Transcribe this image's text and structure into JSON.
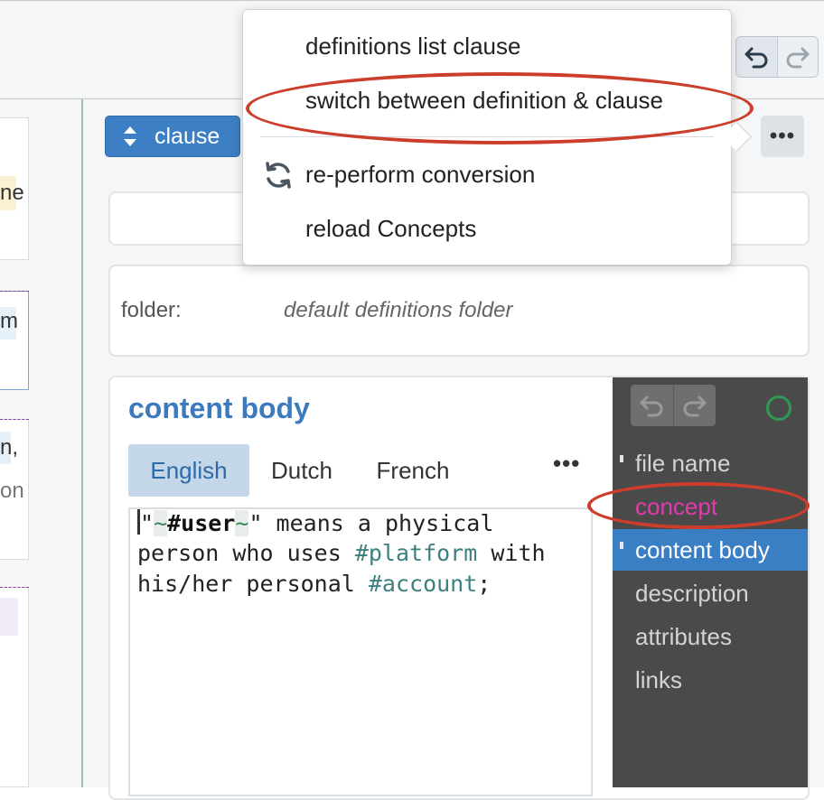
{
  "left_fragments": [
    "ne",
    "m",
    "n,",
    "on"
  ],
  "clause_button": {
    "label": "clause"
  },
  "more_button": {
    "label": "•••"
  },
  "folder": {
    "label": "folder:",
    "value": "default definitions folder"
  },
  "content": {
    "title": "content body",
    "languages": [
      "English",
      "Dutch",
      "French"
    ],
    "active_language": "English",
    "languages_more": "•••",
    "text": {
      "line1_q1": "\"",
      "line1_tilde1": "~",
      "line1_user": "#user",
      "line1_tilde2": "~",
      "line1_rest": "\" means a physical",
      "line2_start": "person who uses ",
      "line2_ref": "#platform",
      "line2_end": " with",
      "line3_start": "his/her personal ",
      "line3_ref": "#account",
      "line3_end": ";"
    }
  },
  "outline": {
    "items": [
      "file name",
      "concept",
      "content body",
      "description",
      "attributes",
      "links"
    ],
    "active": "content body",
    "truncated_item": "..."
  },
  "menu": {
    "items": [
      "definitions list clause",
      "switch between definition & clause",
      "re-perform conversion",
      "reload Concepts"
    ]
  },
  "colors": {
    "primary": "#3c7fc4",
    "annotation": "#cc3d2c",
    "concept_pink": "#e23bb0",
    "status_green": "#2e9a55",
    "outline_bg": "#4a4a4a"
  },
  "icons": {
    "undo": "undo-icon",
    "redo": "redo-icon",
    "clause_toggle": "up-down-caret-icon",
    "refresh": "refresh-icon",
    "status": "status-ring-icon"
  }
}
